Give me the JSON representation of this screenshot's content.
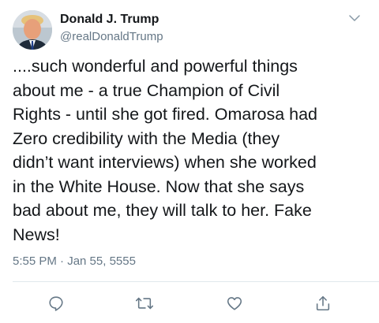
{
  "user": {
    "display_name": "Donald J. Trump",
    "handle": "@realDonaldTrump",
    "avatar_icon": "profile-photo"
  },
  "tweet": {
    "text": "....such wonderful and powerful things\nabout me - a true Champion of Civil\nRights - until she got fired. Omarosa had\nZero credibility with the Media (they\ndidn’t want interviews) when she worked\nin the White House. Now that she says\nbad about me, they will talk to her. Fake\nNews!",
    "timestamp": "5:55 PM · Jan 55, 5555"
  },
  "actions": [
    {
      "icon": "reply-icon"
    },
    {
      "icon": "retweet-icon"
    },
    {
      "icon": "like-icon"
    },
    {
      "icon": "share-icon"
    }
  ],
  "colors": {
    "text": "#14171a",
    "secondary": "#657786",
    "divider": "#e1e8ed"
  }
}
